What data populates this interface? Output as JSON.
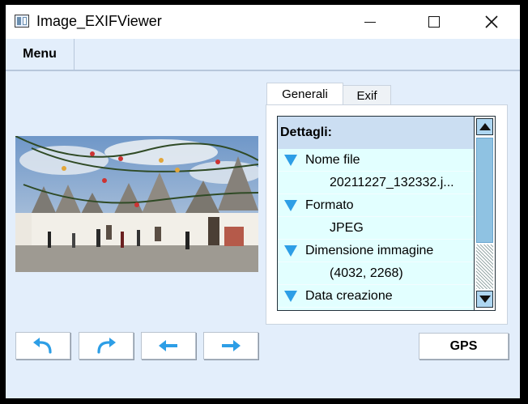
{
  "window": {
    "title": "Image_EXIFViewer"
  },
  "menubar": {
    "menu_label": "Menu"
  },
  "tabs": [
    {
      "label": "Generali",
      "selected": true
    },
    {
      "label": "Exif",
      "selected": false
    }
  ],
  "details": {
    "header": "Dettagli:",
    "groups": [
      {
        "label": "Nome file",
        "value": "20211227_132332.j..."
      },
      {
        "label": "Formato",
        "value": "JPEG"
      },
      {
        "label": "Dimensione immagine",
        "value": "(4032, 2268)"
      },
      {
        "label": "Data creazione"
      }
    ]
  },
  "toolbar": {
    "undo_icon": "undo-arrow-icon",
    "redo_icon": "redo-arrow-icon",
    "prev_icon": "arrow-left-icon",
    "next_icon": "arrow-right-icon",
    "gps_label": "GPS"
  },
  "colors": {
    "accent": "#2d9ee6",
    "list_background": "#e2ffff",
    "window_background": "#e3eefb"
  }
}
